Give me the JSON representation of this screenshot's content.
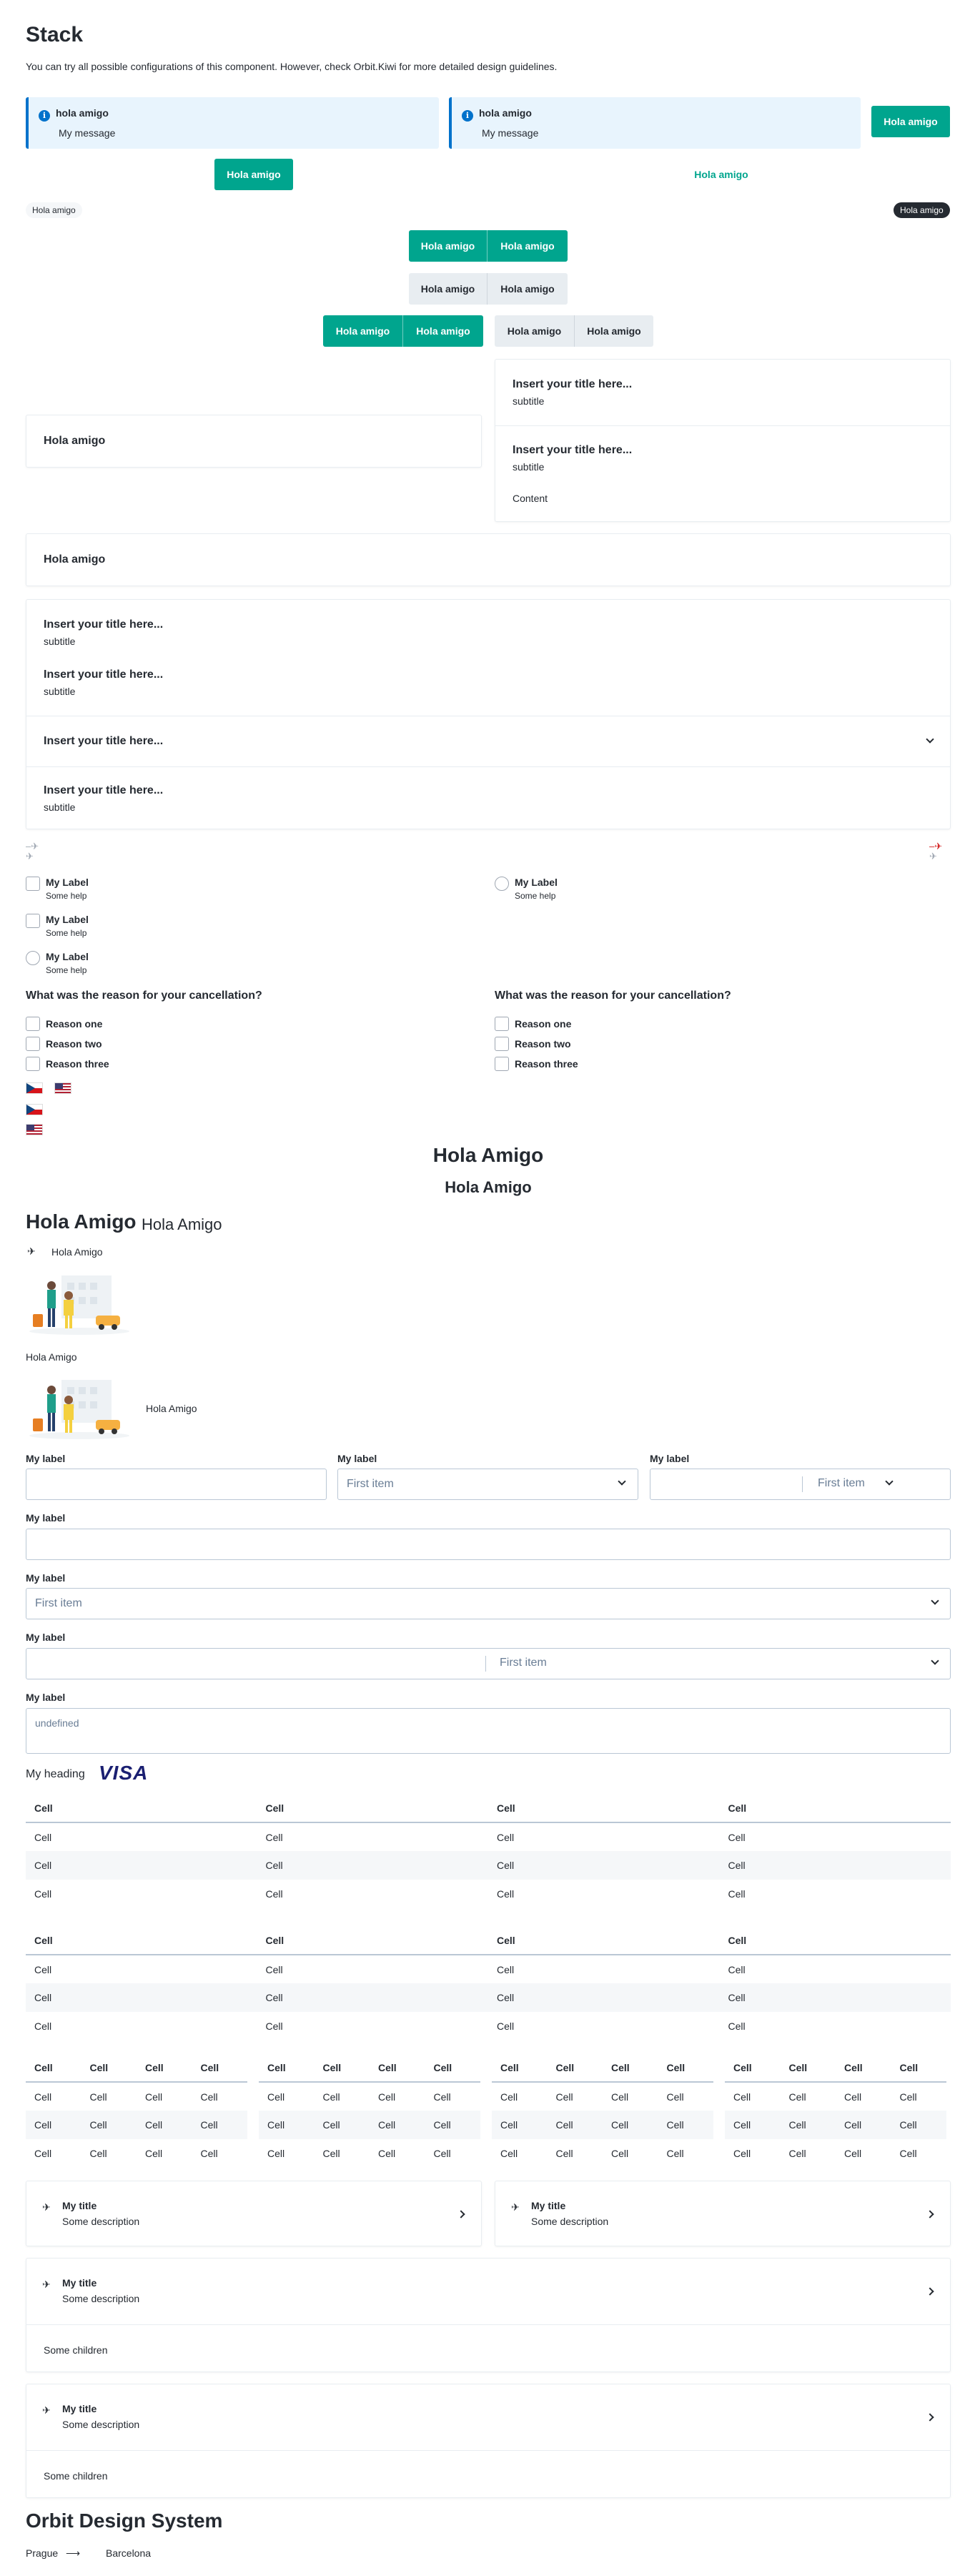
{
  "header": {
    "title": "Stack",
    "intro": "You can try all possible configurations of this component. However, check Orbit.Kiwi for more detailed design guidelines."
  },
  "alerts": [
    {
      "title": "hola amigo",
      "message": "My message"
    },
    {
      "title": "hola amigo",
      "message": "My message"
    }
  ],
  "buttons": {
    "hola": "Hola amigo"
  },
  "badges": {
    "light": "Hola amigo",
    "dark": "Hola amigo"
  },
  "cards": {
    "simple_title": "Hola amigo",
    "section_title": "Insert your title here...",
    "section_subtitle": "subtitle",
    "content": "Content"
  },
  "form": {
    "checkbox_label": "My Label",
    "checkbox_help": "Some help",
    "question": "What was the reason for your cancellation?",
    "reasons": [
      "Reason one",
      "Reason two",
      "Reason three"
    ]
  },
  "headings": {
    "h1": "Hola Amigo",
    "h2": "Hola Amigo",
    "h3a": "Hola Amigo",
    "h3b": "Hola Amigo",
    "icon_text": "Hola Amigo",
    "illustration_caption": "Hola Amigo",
    "illustration_side": "Hola Amigo"
  },
  "fields": {
    "label": "My label",
    "select_value": "First item",
    "textarea_value": "undefined"
  },
  "heading_visa": {
    "heading": "My heading",
    "logo": "VISA"
  },
  "table": {
    "header": "Cell",
    "cell": "Cell"
  },
  "tiles": {
    "title": "My title",
    "description": "Some description",
    "children": "Some children"
  },
  "footer": {
    "title": "Orbit Design System",
    "from": "Prague",
    "to": "Barcelona"
  },
  "colors": {
    "primary": "#00a58e",
    "info": "#0172cb",
    "ink": "#252a31"
  }
}
